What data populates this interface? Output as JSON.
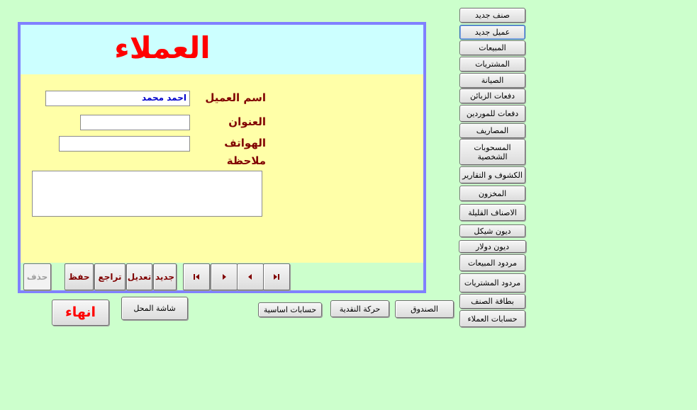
{
  "form": {
    "title": "العملاء",
    "labels": {
      "customer_name": "اسم العميل",
      "address": "العنوان",
      "phones": "الهواتف",
      "note": "ملاحظة"
    },
    "fields": {
      "customer_name": "احمد محمد",
      "address": "",
      "phones": "",
      "note": ""
    },
    "record_buttons": {
      "delete": "حذف",
      "save": "حفظ",
      "undo": "تراجع",
      "edit": "تعديل",
      "new": "جديد"
    },
    "nav_icons": [
      "first-record-icon",
      "previous-record-icon",
      "next-record-icon",
      "last-record-icon"
    ]
  },
  "sidebar": {
    "items": [
      "صنف جديد",
      "عميل جديد",
      "المبيعات",
      "المشتريات",
      "الصيانة",
      "دفعات الزبائن",
      "دفعات للموردين",
      "المصاريف",
      "المسحوبات الشخصية",
      "الكشوف و التقارير",
      "المخزون",
      "الاصناف القليلة",
      "ديون شيكل",
      "ديون دولار",
      "مردود المبيعات",
      "مردود المشتريات",
      "بطاقة الصنف",
      "حسابات العملاء"
    ]
  },
  "bottom": {
    "exit": "انهاء",
    "shop_screen": "شاشة المحل",
    "basic_accounts": "حسابات اساسية",
    "cash_movement": "حركة النقدية",
    "cashbox": "الصندوق"
  },
  "colors": {
    "background": "#ccffcc",
    "header_band": "#ccffff",
    "detail_band": "#ffffa8",
    "frame_border": "#8080ff",
    "title": "#ff0000",
    "label": "#800000",
    "field_text": "#0000cc"
  }
}
